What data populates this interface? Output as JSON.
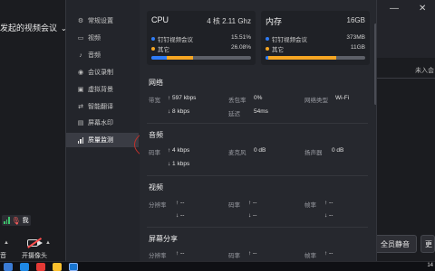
{
  "background": {
    "meeting_title": "发起的视频会议",
    "window_controls": [
      "—",
      "✕"
    ],
    "unjoined_tab": "未入会",
    "mute_all_button": "全员静音",
    "more_button": "更",
    "me_label": "我",
    "camera_label": "开摄像头",
    "left_label": "音"
  },
  "nav": {
    "items": [
      {
        "label": "常规设置",
        "icon": "gear-icon"
      },
      {
        "label": "视频",
        "icon": "video-icon"
      },
      {
        "label": "音频",
        "icon": "audio-icon"
      },
      {
        "label": "会议录制",
        "icon": "record-icon"
      },
      {
        "label": "虚拟背景",
        "icon": "background-icon"
      },
      {
        "label": "智能翻译",
        "icon": "translate-icon"
      },
      {
        "label": "屏幕水印",
        "icon": "watermark-icon"
      },
      {
        "label": "质量监测",
        "icon": "signal-icon",
        "active": true
      }
    ]
  },
  "cpu": {
    "title": "CPU",
    "spec": "4 核 2.11 Ghz",
    "rows": [
      {
        "name": "钉钉视频会议",
        "value": "15.51%",
        "color": "#2f7cf6"
      },
      {
        "name": "其它",
        "value": "26.08%",
        "color": "#f5a623"
      }
    ],
    "usage": [
      0.1551,
      0.2608
    ]
  },
  "memory": {
    "title": "内存",
    "total": "16GB",
    "rows": [
      {
        "name": "钉钉视频会议",
        "value": "373MB",
        "color": "#2f7cf6"
      },
      {
        "name": "其它",
        "value": "11GB",
        "color": "#f5a623"
      }
    ],
    "usage": [
      0.0228,
      0.6875
    ]
  },
  "network": {
    "title": "网络",
    "bandwidth_label": "带宽",
    "up": "↑ 597 kbps",
    "down": "↓ 8 kbps",
    "loss_label": "丢包率",
    "loss": "0%",
    "latency_label": "延迟",
    "latency": "54ms",
    "type_label": "网络类型",
    "type": "Wi-Fi"
  },
  "audio": {
    "title": "音频",
    "bitrate_label": "码率",
    "up": "↑ 4 kbps",
    "down": "↓ 1 kbps",
    "mic_label": "麦克风",
    "mic": "0 dB",
    "speaker_label": "扬声器",
    "speaker": "0 dB"
  },
  "video": {
    "title": "视频",
    "resolution_label": "分辨率",
    "res_up": "↑ --",
    "res_down": "↓ --",
    "bitrate_label": "码率",
    "br_up": "↑ --",
    "br_down": "↓ --",
    "fps_label": "帧率",
    "fps_up": "↑ --",
    "fps_down": "↓ --"
  },
  "screenshare": {
    "title": "屏幕分享",
    "resolution_label": "分辨率",
    "res_up": "↑ --",
    "bitrate_label": "码率",
    "br_up": "↑ --",
    "fps_label": "帧率",
    "fps_up": "↑ --"
  },
  "taskbar": {
    "clock": "14"
  },
  "colors": {
    "accent": "#2f7cf6",
    "other": "#f5a623",
    "annotation": "#c0312b"
  }
}
